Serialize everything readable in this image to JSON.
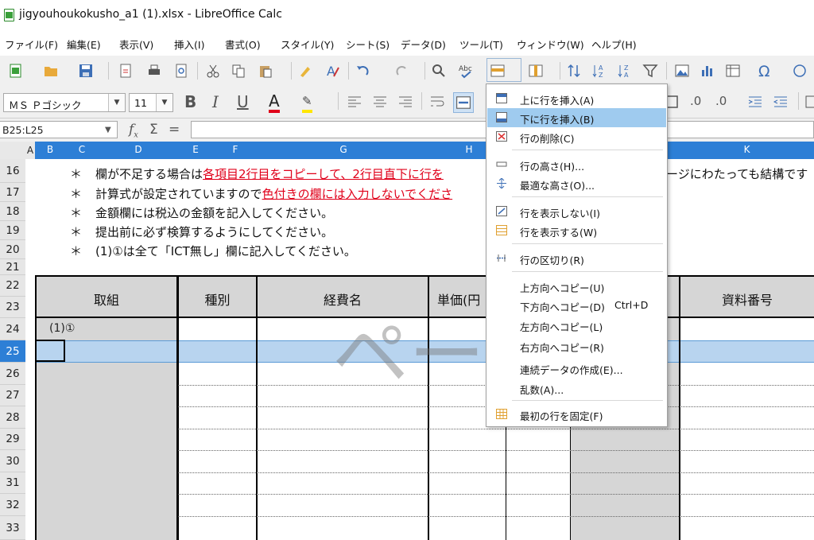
{
  "window": {
    "title": "jigyouhoukokusho_a1 (1).xlsx - LibreOffice Calc"
  },
  "menubar": [
    "ファイル(F)",
    "編集(E)",
    "表示(V)",
    "挿入(I)",
    "書式(O)",
    "スタイル(Y)",
    "シート(S)",
    "データ(D)",
    "ツール(T)",
    "ウィンドウ(W)",
    "ヘルプ(H)"
  ],
  "format": {
    "font_name": "ＭＳ Ｐゴシック",
    "font_size": "11"
  },
  "formula_bar": {
    "name_box": "B25:L25",
    "formula": ""
  },
  "columns": [
    "A",
    "B",
    "C",
    "D",
    "E",
    "F",
    "G",
    "H",
    "K"
  ],
  "rows": [
    "16",
    "17",
    "18",
    "19",
    "20",
    "21",
    "22",
    "23",
    "24",
    "25",
    "26",
    "27",
    "28",
    "29",
    "30",
    "31",
    "32",
    "33"
  ],
  "notes": {
    "n16_a": "欄が不足する場合は",
    "n16_b": "各項目2行目をコピーして、2行目直下に行を",
    "n16_c": "ージにわたっても結構です",
    "n17_a": "計算式が設定されていますので",
    "n17_b": "色付きの欄には入力しないでくださ",
    "n18": "金額欄には税込の金額を記入してください。",
    "n19": "提出前に必ず検算するようにしてください。",
    "n20": "(1)①は全て「ICT無し」欄に記入してください。",
    "star": "＊"
  },
  "table": {
    "headers": [
      "取組",
      "種別",
      "経費名",
      "単価(円",
      "資料番号"
    ],
    "row24_cell": "(1)①"
  },
  "watermark": "ページ 1",
  "context_menu": {
    "items": [
      {
        "label": "上に行を挿入(A)",
        "shortcut": ""
      },
      {
        "label": "下に行を挿入(B)",
        "shortcut": ""
      },
      {
        "label": "行の削除(C)",
        "shortcut": ""
      },
      {
        "label": "行の高さ(H)...",
        "shortcut": ""
      },
      {
        "label": "最適な高さ(O)...",
        "shortcut": ""
      },
      {
        "label": "行を表示しない(I)",
        "shortcut": ""
      },
      {
        "label": "行を表示する(W)",
        "shortcut": ""
      },
      {
        "label": "行の区切り(R)",
        "shortcut": ""
      },
      {
        "label": "上方向へコピー(U)",
        "shortcut": ""
      },
      {
        "label": "下方向へコピー(D)",
        "shortcut": "Ctrl+D"
      },
      {
        "label": "左方向へコピー(L)",
        "shortcut": ""
      },
      {
        "label": "右方向へコピー(R)",
        "shortcut": ""
      },
      {
        "label": "連続データの作成(E)...",
        "shortcut": ""
      },
      {
        "label": "乱数(A)...",
        "shortcut": ""
      },
      {
        "label": "最初の行を固定(F)",
        "shortcut": ""
      }
    ],
    "highlighted": "下に行を挿入(B)"
  },
  "colors": {
    "accent": "#2d7fd6",
    "highlight": "#9fcbef",
    "red_text": "#e0001a",
    "selected_row": "#b8d4ef",
    "locked_cell": "#d6d6d6"
  }
}
